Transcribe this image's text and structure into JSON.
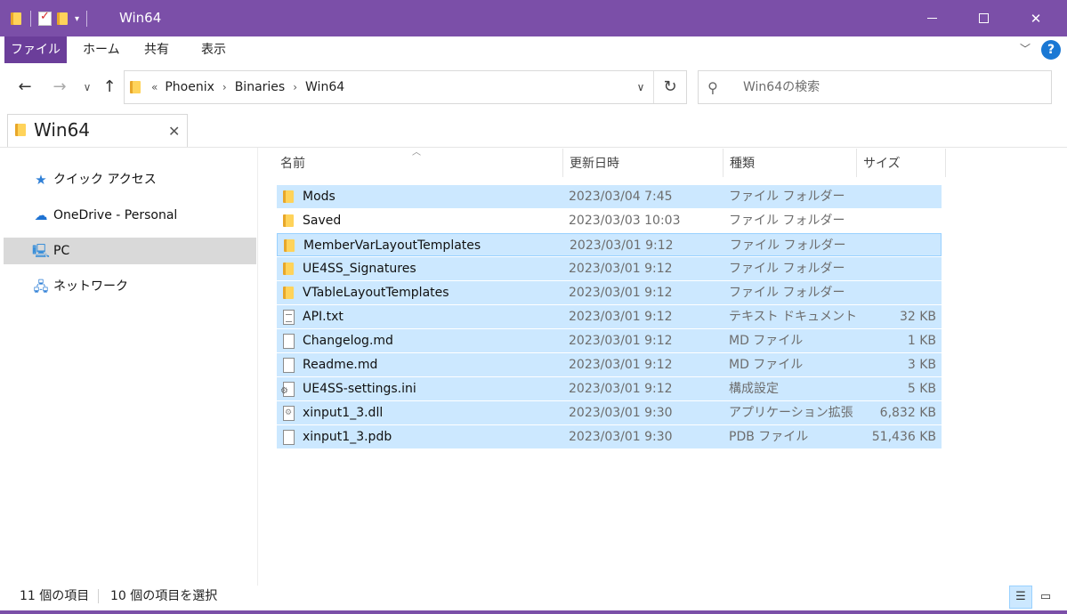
{
  "window": {
    "title": "Win64",
    "minimize_glyph": "",
    "close_glyph": "✕"
  },
  "ribbon": {
    "tabs": [
      "ファイル",
      "ホーム",
      "共有",
      "表示"
    ],
    "help": "?"
  },
  "address": {
    "lead": "«",
    "crumbs": [
      "Phoenix",
      "Binaries",
      "Win64"
    ]
  },
  "search": {
    "placeholder": "Win64の検索"
  },
  "tab": {
    "title": "Win64"
  },
  "navpane": {
    "items": [
      {
        "label": "クイック アクセス",
        "icon": "star-icon"
      },
      {
        "label": "OneDrive - Personal",
        "icon": "onedrive-icon"
      },
      {
        "label": "PC",
        "icon": "pc-icon",
        "selected": true
      },
      {
        "label": "ネットワーク",
        "icon": "network-icon"
      }
    ]
  },
  "columns": {
    "name": "名前",
    "date": "更新日時",
    "type": "種類",
    "size": "サイズ"
  },
  "files": [
    {
      "name": "Mods",
      "date": "2023/03/04 7:45",
      "type": "ファイル フォルダー",
      "size": "",
      "icon": "folder-icon",
      "selected": true
    },
    {
      "name": "Saved",
      "date": "2023/03/03 10:03",
      "type": "ファイル フォルダー",
      "size": "",
      "icon": "folder-icon",
      "selected": false
    },
    {
      "name": "MemberVarLayoutTemplates",
      "date": "2023/03/01 9:12",
      "type": "ファイル フォルダー",
      "size": "",
      "icon": "folder-icon",
      "selected": true
    },
    {
      "name": "UE4SS_Signatures",
      "date": "2023/03/01 9:12",
      "type": "ファイル フォルダー",
      "size": "",
      "icon": "folder-icon",
      "selected": true
    },
    {
      "name": "VTableLayoutTemplates",
      "date": "2023/03/01 9:12",
      "type": "ファイル フォルダー",
      "size": "",
      "icon": "folder-icon",
      "selected": true
    },
    {
      "name": "API.txt",
      "date": "2023/03/01 9:12",
      "type": "テキスト ドキュメント",
      "size": "32 KB",
      "icon": "text-file-icon",
      "selected": true
    },
    {
      "name": "Changelog.md",
      "date": "2023/03/01 9:12",
      "type": "MD ファイル",
      "size": "1 KB",
      "icon": "file-icon",
      "selected": true
    },
    {
      "name": "Readme.md",
      "date": "2023/03/01 9:12",
      "type": "MD ファイル",
      "size": "3 KB",
      "icon": "file-icon",
      "selected": true
    },
    {
      "name": "UE4SS-settings.ini",
      "date": "2023/03/01 9:12",
      "type": "構成設定",
      "size": "5 KB",
      "icon": "settings-file-icon",
      "selected": true
    },
    {
      "name": "xinput1_3.dll",
      "date": "2023/03/01 9:30",
      "type": "アプリケーション拡張",
      "size": "6,832 KB",
      "icon": "dll-file-icon",
      "selected": true
    },
    {
      "name": "xinput1_3.pdb",
      "date": "2023/03/01 9:30",
      "type": "PDB ファイル",
      "size": "51,436 KB",
      "icon": "file-icon",
      "selected": true
    }
  ],
  "status": {
    "count": "11 個の項目",
    "selected": "10 個の項目を選択"
  },
  "colors": {
    "titlebar": "#7b4fa8",
    "file_tab": "#6b3e9a",
    "selection": "#cce8ff",
    "focus_border": "#99d1ff"
  }
}
